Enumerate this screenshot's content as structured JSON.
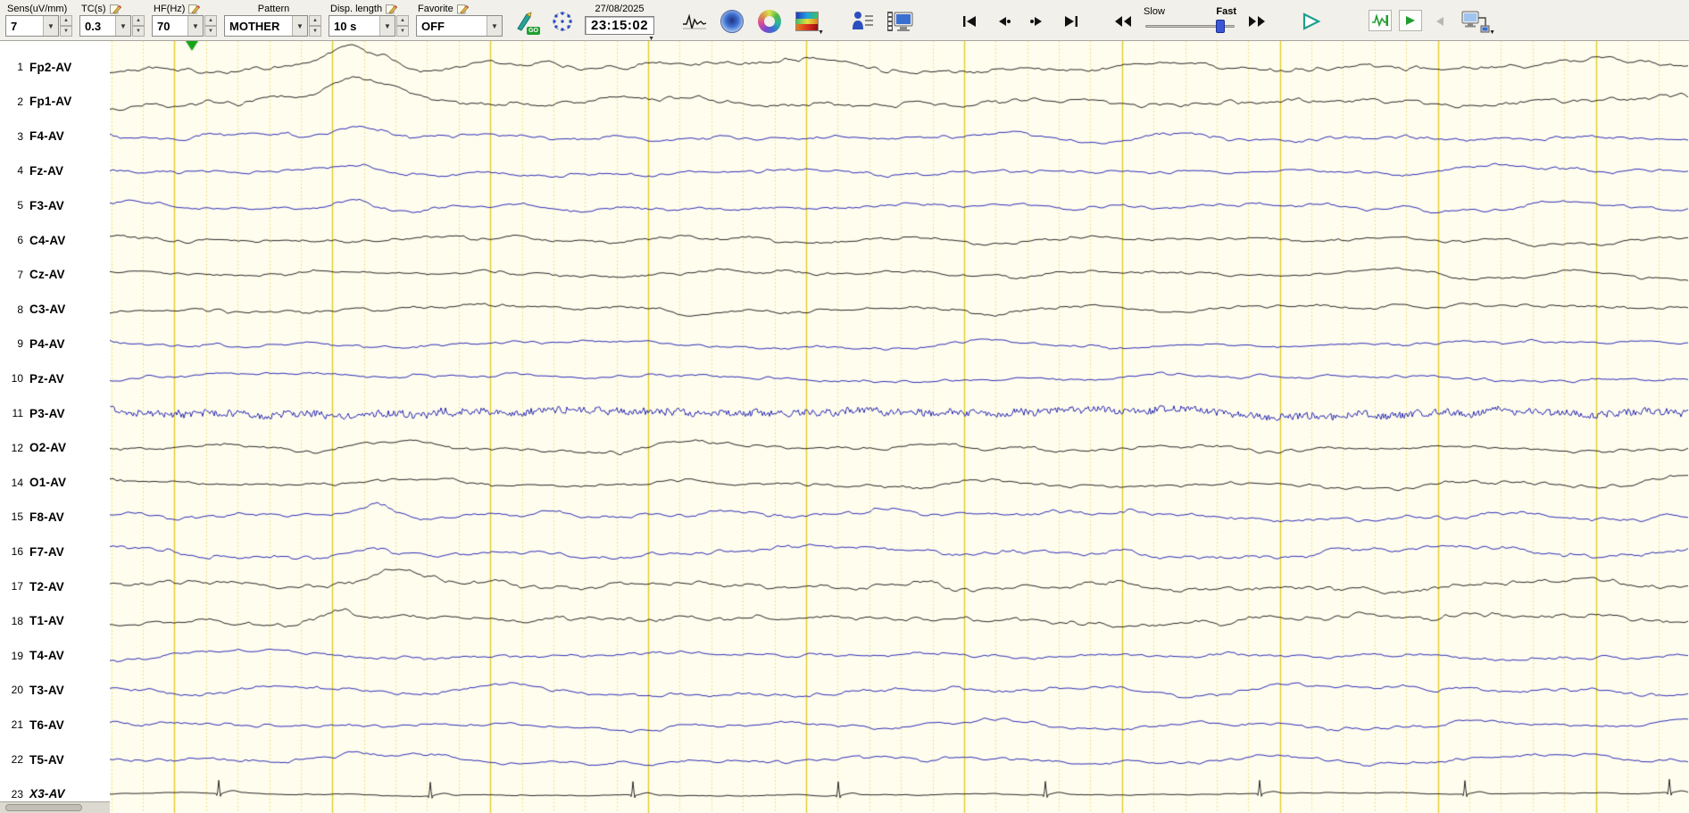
{
  "toolbar": {
    "fields": [
      {
        "label": "Sens(uV/mm)",
        "value": "7"
      },
      {
        "label": "TC(s)",
        "value": "0.3"
      },
      {
        "label": "HF(Hz)",
        "value": "70"
      },
      {
        "label": "Pattern",
        "value": "MOTHER"
      },
      {
        "label": "Disp. length",
        "value": "10 s"
      },
      {
        "label": "Favorite",
        "value": "OFF"
      }
    ],
    "go_badge": "GO",
    "date": "27/08/2025",
    "time": "23:15:02",
    "slider": {
      "slow": "Slow",
      "fast": "Fast"
    }
  },
  "channels": [
    {
      "num": "1",
      "label": "Fp2-AV",
      "color": "black"
    },
    {
      "num": "2",
      "label": "Fp1-AV",
      "color": "black"
    },
    {
      "num": "3",
      "label": "F4-AV",
      "color": "blue"
    },
    {
      "num": "4",
      "label": "Fz-AV",
      "color": "blue"
    },
    {
      "num": "5",
      "label": "F3-AV",
      "color": "blue"
    },
    {
      "num": "6",
      "label": "C4-AV",
      "color": "black"
    },
    {
      "num": "7",
      "label": "Cz-AV",
      "color": "black"
    },
    {
      "num": "8",
      "label": "C3-AV",
      "color": "black"
    },
    {
      "num": "9",
      "label": "P4-AV",
      "color": "blue"
    },
    {
      "num": "10",
      "label": "Pz-AV",
      "color": "blue"
    },
    {
      "num": "11",
      "label": "P3-AV",
      "color": "blue",
      "dense": true
    },
    {
      "num": "12",
      "label": "O2-AV",
      "color": "black"
    },
    {
      "num": "14",
      "label": "O1-AV",
      "color": "black"
    },
    {
      "num": "15",
      "label": "F8-AV",
      "color": "blue"
    },
    {
      "num": "16",
      "label": "F7-AV",
      "color": "blue"
    },
    {
      "num": "17",
      "label": "T2-AV",
      "color": "black"
    },
    {
      "num": "18",
      "label": "T1-AV",
      "color": "black"
    },
    {
      "num": "19",
      "label": "T4-AV",
      "color": "blue"
    },
    {
      "num": "20",
      "label": "T3-AV",
      "color": "blue"
    },
    {
      "num": "21",
      "label": "T6-AV",
      "color": "blue"
    },
    {
      "num": "22",
      "label": "T5-AV",
      "color": "blue"
    },
    {
      "num": "23",
      "label": "X3-AV",
      "color": "black",
      "italic": true,
      "ecg": true
    }
  ],
  "grid": {
    "display_seconds": 10,
    "minor_per_major": 5
  },
  "colors": {
    "paper": "#fffdee",
    "grid_major": "#e2cd2e",
    "grid_minor": "#eadb63",
    "trace_black": "#1c1c1c",
    "trace_blue": "#2323b2",
    "marker_green": "#17a317"
  }
}
